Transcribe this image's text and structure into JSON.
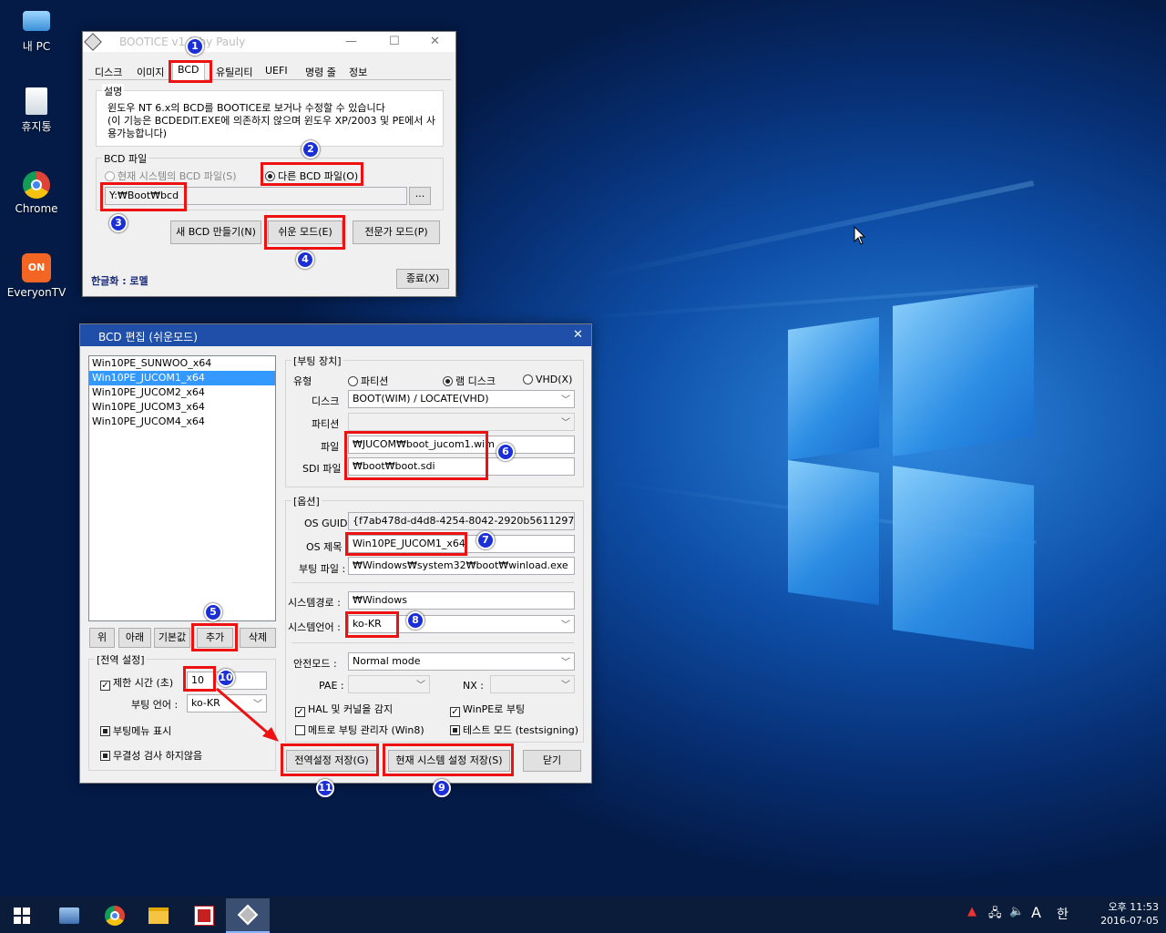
{
  "desktop": {
    "icons": [
      {
        "label": "내 PC",
        "icon": "computer-icon"
      },
      {
        "label": "휴지통",
        "icon": "recycle-bin-icon"
      },
      {
        "label": "Chrome",
        "icon": "chrome-icon"
      },
      {
        "label": "EveryonTV",
        "icon": "everyontv-icon"
      }
    ]
  },
  "bootice": {
    "title": "BOOTICE v1.3 by Pauly",
    "tabs": [
      "디스크",
      "이미지",
      "BCD",
      "유틸리티",
      "UEFI",
      "명령 줄",
      "정보"
    ],
    "desc_group": "설명",
    "desc_line1": "윈도우 NT 6.x의 BCD를 BOOTICE로 보거나 수정할 수 있습니다",
    "desc_line2": "(이 기능은 BCDEDIT.EXE에 의존하지 않으며 윈도우 XP/2003 및 PE에서 사",
    "desc_line3": "용가능합니다)",
    "bcd_group": "BCD 파일",
    "radio_current": "현재 시스템의 BCD 파일(S)",
    "radio_other": "다른 BCD 파일(O)",
    "bcd_path": "Y:₩Boot₩bcd",
    "browse": "...",
    "btn_new": "새 BCD 만들기(N)",
    "btn_easy": "쉬운 모드(E)",
    "btn_expert": "전문가 모드(P)",
    "credit": "한글화 : 로멜",
    "btn_exit": "종료(X)"
  },
  "bcd_edit": {
    "title": "BCD 편집 (쉬운모드)",
    "entries": [
      "Win10PE_SUNWOO_x64",
      "Win10PE_JUCOM1_x64",
      "Win10PE_JUCOM2_x64",
      "Win10PE_JUCOM3_x64",
      "Win10PE_JUCOM4_x64"
    ],
    "selected_entry": 1,
    "btn_up": "위",
    "btn_down": "아래",
    "btn_default": "기본값",
    "btn_add": "추가",
    "btn_delete": "삭제",
    "global_group": "[전역 설정]",
    "timeout_label": "제한 시간 (초)",
    "timeout_value": "10",
    "boot_lang_label": "부팅 언어 :",
    "boot_lang_value": "ko-KR",
    "show_menu": "부팅메뉴 표시",
    "no_integrity": "무결성 검사 하지않음",
    "device_group": "[부팅 장치]",
    "type_label": "유형",
    "type_partition": "파티션",
    "type_ramdisk": "램 디스크",
    "type_vhd": "VHD(X)",
    "disk_label": "디스크",
    "disk_value": "BOOT(WIM) / LOCATE(VHD)",
    "partition_label": "파티션",
    "file_label": "파일",
    "file_value": "₩JUCOM₩boot_jucom1.wim",
    "sdi_label": "SDI 파일",
    "sdi_value": "₩boot₩boot.sdi",
    "options_group": "[옵션]",
    "guid_label": "OS GUID",
    "guid_value": "{f7ab478d-d4d8-4254-8042-2920b5611297}",
    "os_title_label": "OS 제목",
    "os_title_value": "Win10PE_JUCOM1_x64",
    "boot_file_label": "부팅 파일 :",
    "boot_file_value": "₩Windows₩system32₩boot₩winload.exe",
    "sys_path_label": "시스템경로 :",
    "sys_path_value": "₩Windows",
    "sys_lang_label": "시스템언어 :",
    "sys_lang_value": "ko-KR",
    "safe_mode_label": "안전모드 :",
    "safe_mode_value": "Normal mode",
    "pae_label": "PAE :",
    "nx_label": "NX :",
    "hal_detect": "HAL 및 커널을 감지",
    "winpe_boot": "WinPE로 부팅",
    "metro": "메트로 부팅 관리자 (Win8)",
    "testsigning": "테스트 모드 (testsigning)",
    "btn_save_global": "전역설정 저장(G)",
    "btn_save_current": "현재 시스템 설정 저장(S)",
    "btn_close": "닫기"
  },
  "annotations": [
    "1",
    "2",
    "3",
    "4",
    "5",
    "6",
    "7",
    "8",
    "9",
    "10",
    "11"
  ],
  "taskbar": {
    "time": "오후 11:53",
    "date": "2016-07-05",
    "ime": "A",
    "lang": "한"
  }
}
